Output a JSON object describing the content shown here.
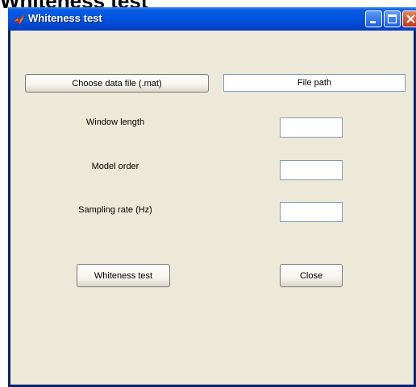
{
  "document_caption": "Whiteness test",
  "window": {
    "title": "Whiteness test",
    "controls": {
      "minimize": "minimize-icon",
      "maximize": "maximize-icon",
      "close": "close-icon"
    }
  },
  "form": {
    "choose_file_label": "Choose data file (.mat)",
    "file_path_text": "File path",
    "window_length_label": "Window length",
    "window_length_value": "",
    "model_order_label": "Model order",
    "model_order_value": "",
    "sampling_rate_label": "Sampling rate (Hz)",
    "sampling_rate_value": "",
    "whiteness_test_button": "Whiteness test",
    "close_button": "Close"
  },
  "colors": {
    "titlebar": "#0054e3",
    "client_bg": "#ece9d8",
    "close_btn": "#c33716"
  }
}
